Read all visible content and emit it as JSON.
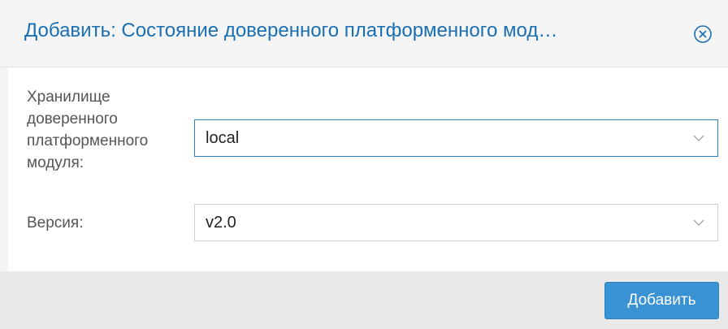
{
  "dialog": {
    "title": "Добавить: Состояние доверенного платформенного мод…",
    "close_icon": "close-circle-icon",
    "accent_color": "#1a6fb3"
  },
  "form": {
    "storage": {
      "label": "Хранилище доверенного платформенного модуля:",
      "value": "local"
    },
    "version": {
      "label": "Версия:",
      "value": "v2.0"
    }
  },
  "footer": {
    "add_label": "Добавить",
    "button_color": "#3892d4"
  }
}
